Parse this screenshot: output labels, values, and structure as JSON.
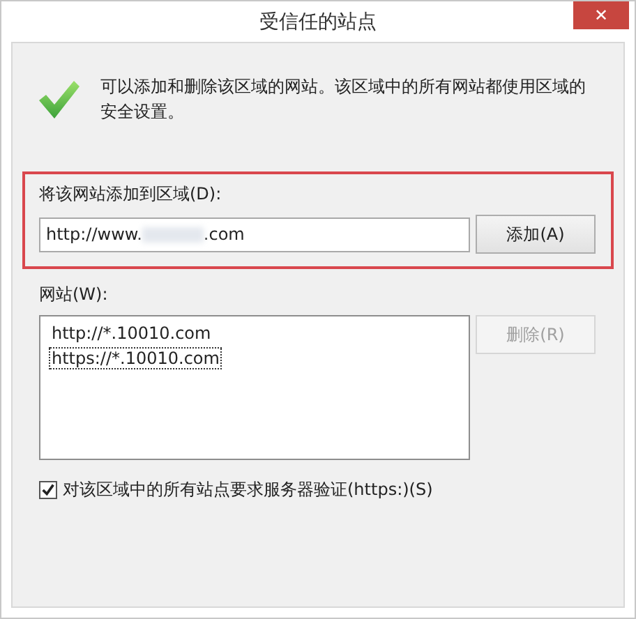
{
  "window": {
    "title": "受信任的站点",
    "close_label": "✕"
  },
  "info": {
    "text": "可以添加和删除该区域的网站。该区域中的所有网站都使用区域的安全设置。"
  },
  "add_section": {
    "highlighted": true,
    "label": "将该网站添加到区域(D):",
    "field": {
      "value_start": "http://www.",
      "value_end": ".com",
      "redacted": true
    },
    "button": {
      "label": "添加(A)",
      "disabled": false
    }
  },
  "sites": {
    "label": "网站(W):",
    "items": [
      {
        "text": "http://*.10010.com",
        "focused": false
      },
      {
        "text": "https://*.10010.com",
        "focused": true
      }
    ],
    "delete_button": {
      "label": "删除(R)",
      "disabled": true
    }
  },
  "require_https": {
    "label": "对该区域中的所有站点要求服务器验证(https:)(S)",
    "checked": true
  }
}
